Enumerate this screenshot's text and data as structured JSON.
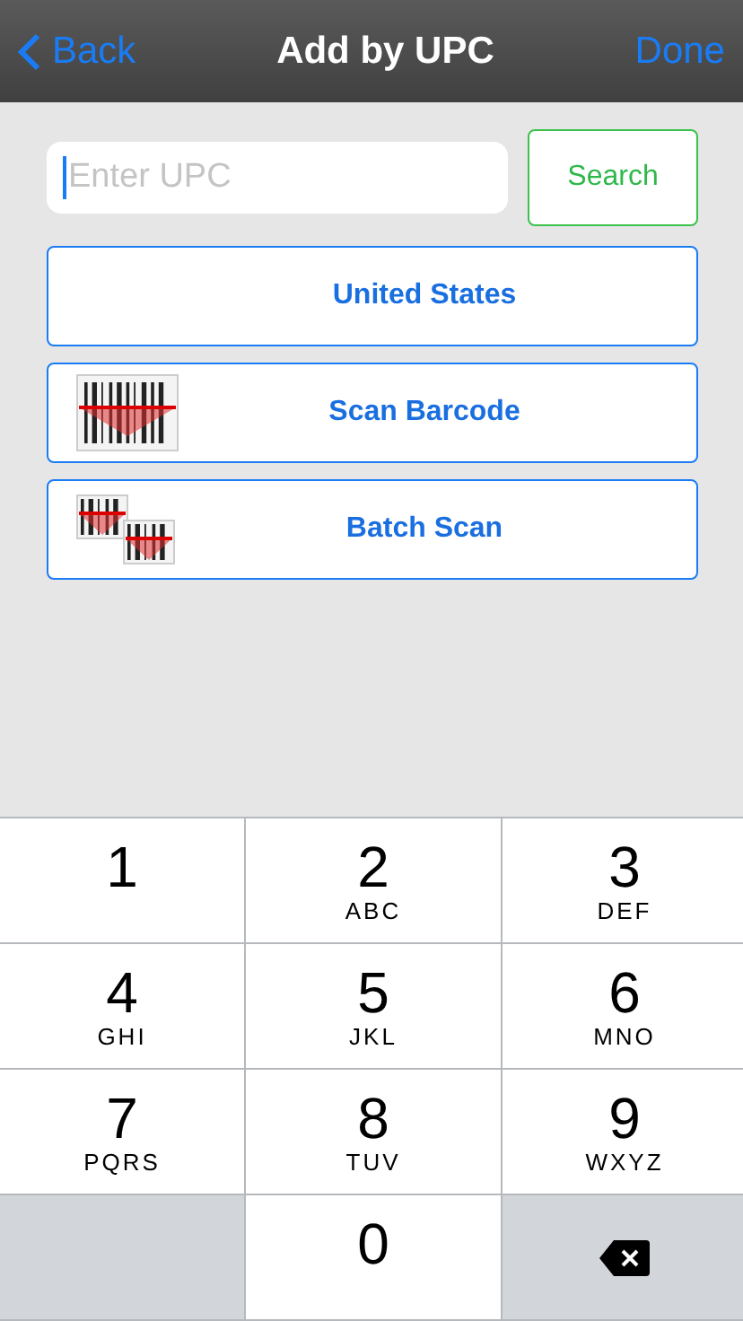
{
  "nav_bar": {
    "back": "Back",
    "title": "Add by UPC",
    "done": "Done"
  },
  "upc_field": {
    "placeholder": "Enter UPC"
  },
  "search_button": "Search",
  "actions": [
    {
      "kind": "plain",
      "label": "United States"
    },
    {
      "kind": "scan",
      "label": "Scan Barcode"
    },
    {
      "kind": "batch",
      "label": "Batch Scan"
    }
  ],
  "keypad": [
    {
      "kind": "digit",
      "digit": "1"
    },
    {
      "kind": "digit",
      "digit": "2",
      "letters": "ABC"
    },
    {
      "kind": "digit",
      "digit": "3",
      "letters": "DEF"
    },
    {
      "kind": "digit",
      "digit": "4",
      "letters": "GHI"
    },
    {
      "kind": "digit",
      "digit": "5",
      "letters": "JKL"
    },
    {
      "kind": "digit",
      "digit": "6",
      "letters": "MNO"
    },
    {
      "kind": "digit",
      "digit": "7",
      "letters": "PQRS"
    },
    {
      "kind": "digit",
      "digit": "8",
      "letters": "TUV"
    },
    {
      "kind": "digit",
      "digit": "9",
      "letters": "WXYZ"
    },
    {
      "kind": "blank"
    },
    {
      "kind": "digit",
      "digit": "0"
    },
    {
      "kind": "delete"
    }
  ]
}
